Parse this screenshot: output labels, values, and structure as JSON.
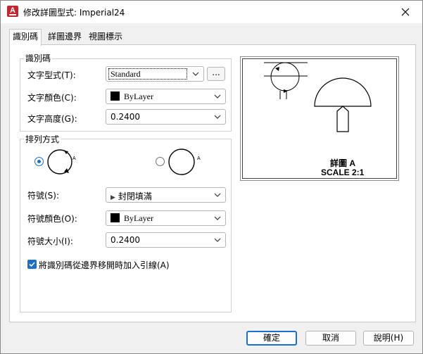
{
  "window": {
    "title": "修改詳圖型式: Imperial24"
  },
  "tabs": [
    "識別碼",
    "詳圖邊界",
    "視圖標示"
  ],
  "identifier": {
    "group_label": "識別碼",
    "text_style_label": "文字型式(T):",
    "text_style_value": "Standard",
    "browse_label": "...",
    "text_color_label": "文字顏色(C):",
    "text_color_value": "ByLayer",
    "text_height_label": "文字高度(G):",
    "text_height_value": "0.2400"
  },
  "arrangement": {
    "group_label": "排列方式",
    "option1_text": "A",
    "option2_text": "A",
    "symbol_label": "符號(S):",
    "symbol_value": "封閉填滿",
    "symbol_color_label": "符號顏色(O):",
    "symbol_color_value": "ByLayer",
    "symbol_size_label": "符號大小(I):",
    "symbol_size_value": "0.2400",
    "leader_checkbox_label": "將識別碼從邊界移開時加入引線(A)",
    "leader_checked": true,
    "selected_option": 1
  },
  "preview": {
    "title_line1": "詳圖 A",
    "title_line2": "SCALE 2:1"
  },
  "footer": {
    "ok": "確定",
    "cancel": "取消",
    "help": "說明(H)"
  },
  "colors": {
    "accent": "#1a6fc8",
    "app_icon": "#c4262e"
  }
}
